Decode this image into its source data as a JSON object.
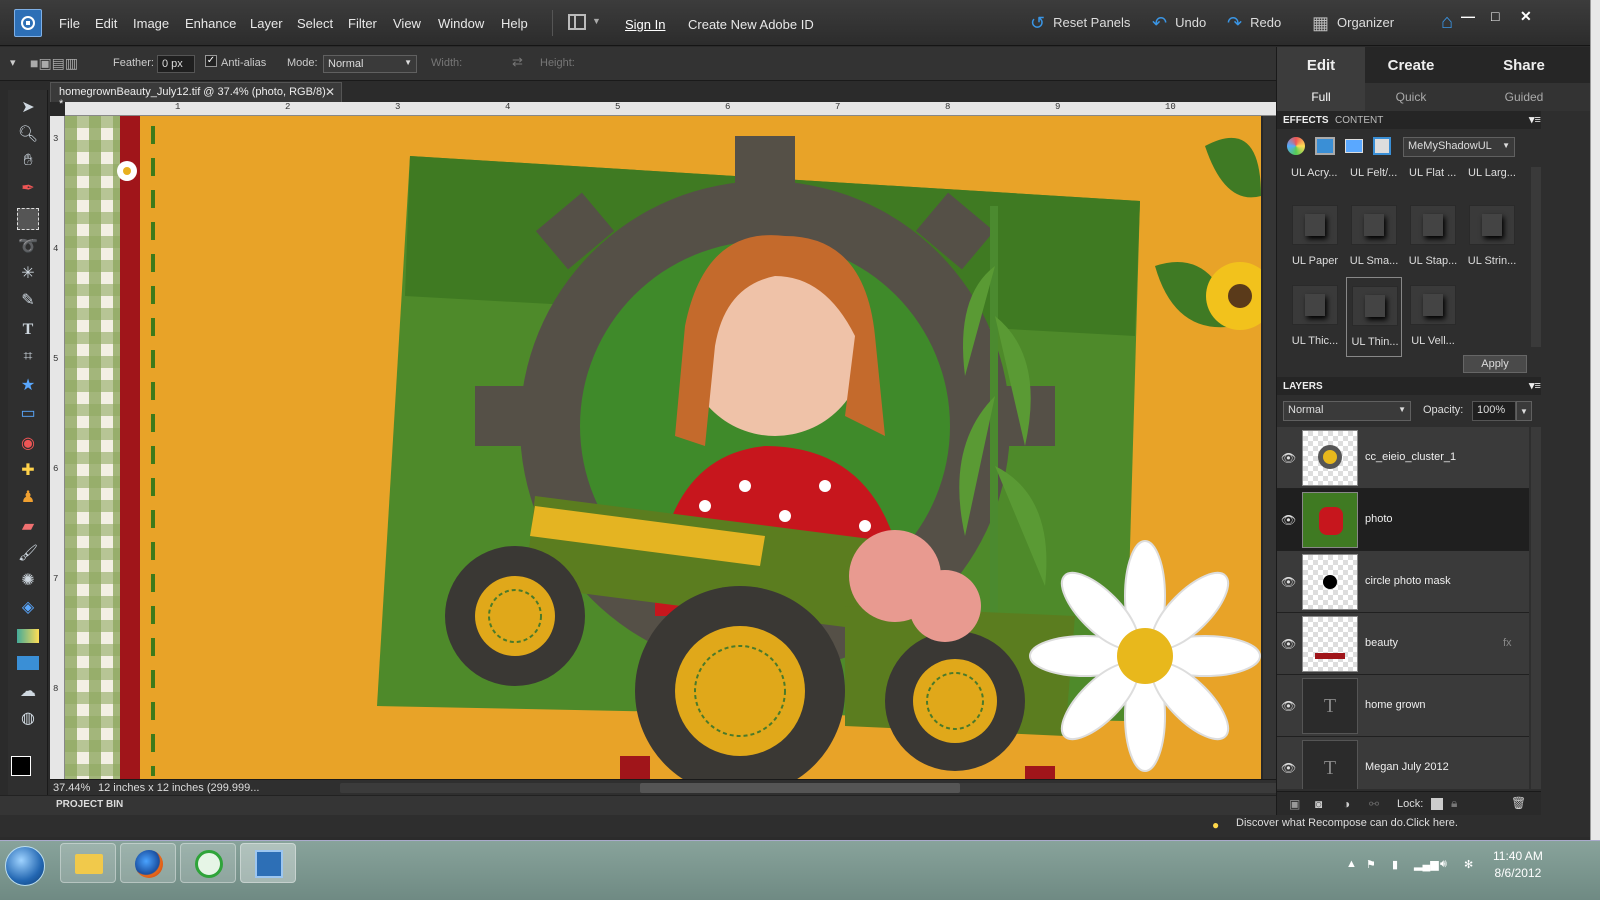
{
  "menubar": {
    "items": [
      "File",
      "Edit",
      "Image",
      "Enhance",
      "Layer",
      "Select",
      "Filter",
      "View",
      "Window",
      "Help"
    ],
    "sign_in": "Sign In",
    "create_id": "Create New Adobe ID",
    "reset_panels": "Reset Panels",
    "undo": "Undo",
    "redo": "Redo",
    "organizer": "Organizer"
  },
  "options": {
    "feather_label": "Feather:",
    "feather_value": "0 px",
    "antialias_label": "Anti-alias",
    "mode_label": "Mode:",
    "mode_value": "Normal",
    "width_label": "Width:",
    "height_label": "Height:"
  },
  "document": {
    "tab_title": "homegrownBeauty_July12.tif @ 37.4% (photo, RGB/8) *",
    "zoom": "37.44%",
    "size": "12 inches x 12 inches (299.999...",
    "ruler_h": [
      "1",
      "2",
      "3",
      "4",
      "5",
      "6",
      "7",
      "8",
      "9",
      "10"
    ],
    "ruler_v": [
      "3",
      "4",
      "5",
      "6",
      "7",
      "8"
    ]
  },
  "project_bin": "PROJECT BIN",
  "tip": "Discover what Recompose can do.Click here.",
  "panel": {
    "tabs": [
      "Edit",
      "Create",
      "Share"
    ],
    "subtabs": [
      "Full",
      "Quick",
      "Guided"
    ],
    "effects_tab": "EFFECTS",
    "content_tab": "CONTENT",
    "effects_dropdown": "MeMyShadowUL",
    "top_row": [
      "UL Acry...",
      "UL Felt/...",
      "UL Flat ...",
      "UL Larg..."
    ],
    "effects": [
      "UL Paper",
      "UL Sma...",
      "UL Stap...",
      "UL Strin...",
      "UL Thic...",
      "UL Thin...",
      "UL Vell..."
    ],
    "apply": "Apply"
  },
  "layers": {
    "title": "LAYERS",
    "blend": "Normal",
    "opacity_label": "Opacity:",
    "opacity": "100%",
    "lock_label": "Lock:",
    "items": [
      "cc_eieio_cluster_1",
      "photo",
      "circle photo mask",
      "beauty",
      "home grown",
      "Megan July 2012"
    ]
  },
  "taskbar": {
    "time": "11:40 AM",
    "date": "8/6/2012"
  }
}
